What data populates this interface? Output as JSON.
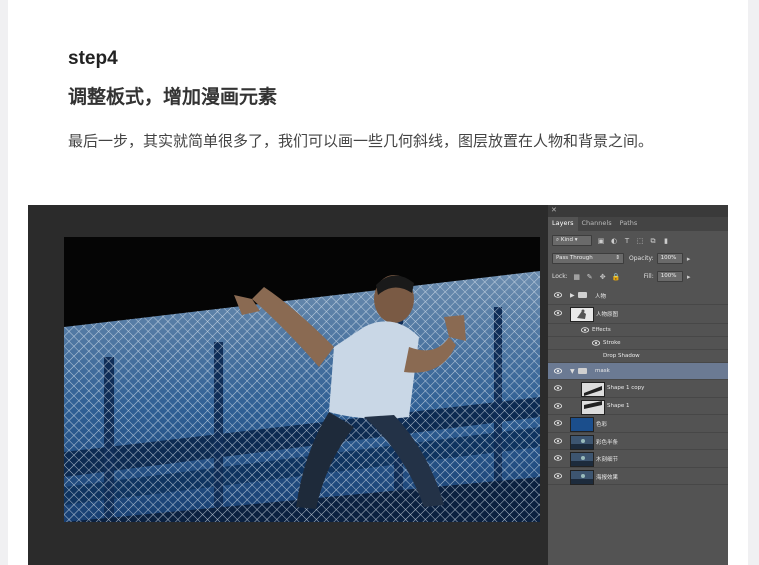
{
  "article": {
    "step_title": "step4",
    "subtitle": "调整板式，增加漫画元素",
    "body": "最后一步，其实就简单很多了，我们可以画一些几何斜线，图层放置在人物和背景之间。"
  },
  "photoshop": {
    "panel_tabs": [
      "Layers",
      "Channels",
      "Paths"
    ],
    "active_tab": "Layers",
    "kind_label": "Kind",
    "blend_mode": "Pass Through",
    "opacity_label": "Opacity:",
    "opacity_value": "100%",
    "lock_label": "Lock:",
    "fill_label": "Fill:",
    "fill_value": "100%",
    "layers": [
      {
        "name": "人物",
        "type": "folder",
        "indent": 0,
        "expanded": false
      },
      {
        "name": "人物原图",
        "type": "layer",
        "indent": 0,
        "thumb": "person"
      },
      {
        "name": "Effects",
        "type": "effect",
        "indent": 1
      },
      {
        "name": "Stroke",
        "type": "effect",
        "indent": 2
      },
      {
        "name": "Drop Shadow",
        "type": "effect",
        "indent": 2
      },
      {
        "name": "mask",
        "type": "folder",
        "indent": 0,
        "expanded": true,
        "selected": true
      },
      {
        "name": "Shape 1 copy",
        "type": "layer",
        "indent": 1,
        "thumb": "shape"
      },
      {
        "name": "Shape 1",
        "type": "layer",
        "indent": 1,
        "thumb": "shape"
      },
      {
        "name": "色彩",
        "type": "layer",
        "indent": 0,
        "thumb": "color"
      },
      {
        "name": "彩色半条",
        "type": "layer",
        "indent": 0,
        "thumb": "photo"
      },
      {
        "name": "木刻细节",
        "type": "layer",
        "indent": 0,
        "thumb": "photo"
      },
      {
        "name": "海报效果",
        "type": "layer",
        "indent": 0,
        "thumb": "photo"
      }
    ],
    "accent_color": "#1b4e8c"
  }
}
